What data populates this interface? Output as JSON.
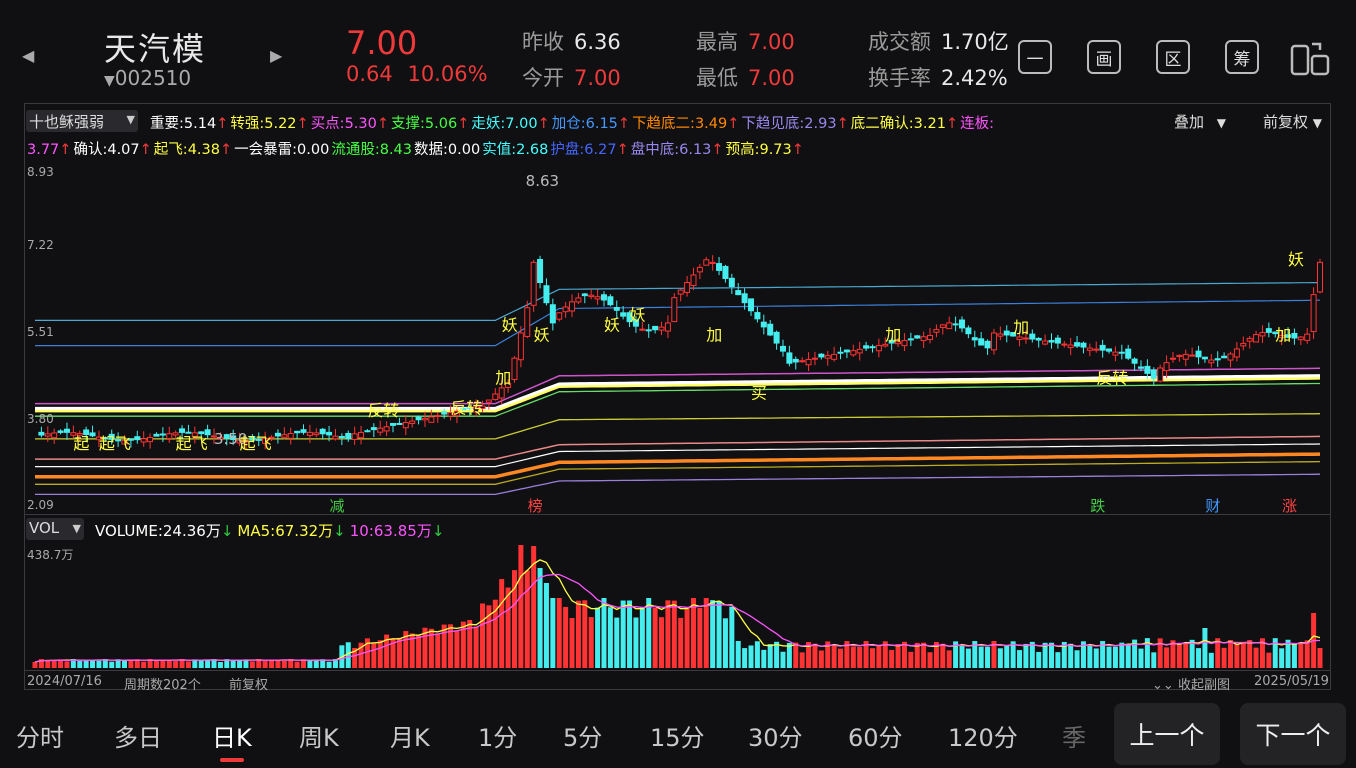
{
  "header": {
    "name": "天汽模",
    "code": "002510",
    "price": "7.00",
    "change": "0.64",
    "change_pct": "10.06%",
    "stats": [
      {
        "label": "昨收",
        "value": "6.36",
        "color": "#e8e8e8"
      },
      {
        "label": "今开",
        "value": "7.00",
        "color": "#f03a3a"
      },
      {
        "label": "最高",
        "value": "7.00",
        "color": "#f03a3a"
      },
      {
        "label": "最低",
        "value": "7.00",
        "color": "#f03a3a"
      },
      {
        "label": "成交额",
        "value": "1.70亿",
        "color": "#e8e8e8"
      },
      {
        "label": "换手率",
        "value": "2.42%",
        "color": "#e8e8e8"
      }
    ],
    "tools": [
      "一",
      "画",
      "区",
      "筹"
    ]
  },
  "indicator": {
    "selector": "十也稣强弱",
    "overlay": "叠加",
    "adjust": "前复权",
    "items": [
      {
        "label": "重要:",
        "value": "5.14",
        "color": "#ffffff",
        "dir": "up"
      },
      {
        "label": "转强:",
        "value": "5.22",
        "color": "#ffff44",
        "dir": "up"
      },
      {
        "label": "买点:",
        "value": "5.30",
        "color": "#ff55ff",
        "dir": "up"
      },
      {
        "label": "支撑:",
        "value": "5.06",
        "color": "#44ff44",
        "dir": "up"
      },
      {
        "label": "走妖:",
        "value": "7.00",
        "color": "#44ffff",
        "dir": "up"
      },
      {
        "label": "加仓:",
        "value": "6.15",
        "color": "#4499ff",
        "dir": "up"
      },
      {
        "label": "下趋底二:",
        "value": "3.49",
        "color": "#ff8800",
        "dir": "up"
      },
      {
        "label": "下趋见底:",
        "value": "2.93",
        "color": "#9988ee",
        "dir": "up"
      },
      {
        "label": "底二确认:",
        "value": "3.21",
        "color": "#ffff44",
        "dir": "up"
      },
      {
        "label": "连板:",
        "value": "3.77",
        "color": "#ff55ff",
        "dir": "up"
      },
      {
        "label": "确认:",
        "value": "4.07",
        "color": "#ffffff",
        "dir": "up"
      },
      {
        "label": "起飞:",
        "value": "4.38",
        "color": "#ffff44",
        "dir": "up"
      },
      {
        "label": "一会暴雷:",
        "value": "0.00",
        "color": "#ffffff",
        "dir": ""
      },
      {
        "label": "流通股:",
        "value": "8.43",
        "color": "#44ff44",
        "dir": ""
      },
      {
        "label": "数据:",
        "value": "0.00",
        "color": "#ffffff",
        "dir": ""
      },
      {
        "label": "实值:",
        "value": "2.68",
        "color": "#44ffff",
        "dir": ""
      },
      {
        "label": "护盘:",
        "value": "6.27",
        "color": "#4466ff",
        "dir": "up"
      },
      {
        "label": "盘中底:",
        "value": "6.13",
        "color": "#9988ee",
        "dir": "up"
      },
      {
        "label": "预高:",
        "value": "9.73",
        "color": "#ffff44",
        "dir": "up"
      }
    ]
  },
  "price_axis": [
    "8.93",
    "7.22",
    "5.51",
    "3.80",
    "2.09"
  ],
  "peak_label": "8.63",
  "low_label": "3.50",
  "chart_tags": [
    {
      "text": "起",
      "color": "#ffff44"
    },
    {
      "text": "起飞",
      "color": "#ffff44"
    },
    {
      "text": "起飞",
      "color": "#ffff44"
    },
    {
      "text": "起飞",
      "color": "#ffff44"
    },
    {
      "text": "反转",
      "color": "#ffff44"
    },
    {
      "text": "反转",
      "color": "#ffff44"
    },
    {
      "text": "加",
      "color": "#ffff44"
    },
    {
      "text": "妖",
      "color": "#ffff44"
    },
    {
      "text": "妖",
      "color": "#ffff44"
    },
    {
      "text": "妖",
      "color": "#ffff44"
    },
    {
      "text": "妖",
      "color": "#ffff44"
    },
    {
      "text": "加",
      "color": "#ffff44"
    },
    {
      "text": "买",
      "color": "#ffff44"
    },
    {
      "text": "加",
      "color": "#ffff44"
    },
    {
      "text": "加",
      "color": "#ffff44"
    },
    {
      "text": "反转",
      "color": "#ffff44"
    },
    {
      "text": "加",
      "color": "#ffff44"
    },
    {
      "text": "妖",
      "color": "#ffff44"
    }
  ],
  "bottom_tags": [
    {
      "text": "减",
      "color": "#44cc44"
    },
    {
      "text": "榜",
      "color": "#ff4444"
    },
    {
      "text": "跌",
      "color": "#44cc44"
    },
    {
      "text": "财",
      "color": "#4499ff"
    },
    {
      "text": "涨",
      "color": "#ff4444"
    }
  ],
  "volume": {
    "selector": "VOL",
    "items": [
      {
        "label": "VOLUME:",
        "value": "24.36万",
        "color": "#ffffff",
        "arrow": "↓",
        "arrow_color": "#2ecc40"
      },
      {
        "label": "MA5:",
        "value": "67.32万",
        "color": "#ffff44",
        "arrow": "↓",
        "arrow_color": "#2ecc40"
      },
      {
        "label": "10:",
        "value": "63.85万",
        "color": "#ff55ff",
        "arrow": "↓",
        "arrow_color": "#2ecc40"
      }
    ],
    "axis_max": "438.7万"
  },
  "footer": {
    "start_date": "2024/07/16",
    "period_count": "周期数202个",
    "adjust": "前复权",
    "collapse": "收起副图",
    "end_date": "2025/05/19"
  },
  "tabs": [
    "分时",
    "多日",
    "日K",
    "周K",
    "月K",
    "1分",
    "5分",
    "15分",
    "30分",
    "60分",
    "120分",
    "季"
  ],
  "active_tab": "日K",
  "nav_prev": "上一个",
  "nav_next": "下一个"
}
